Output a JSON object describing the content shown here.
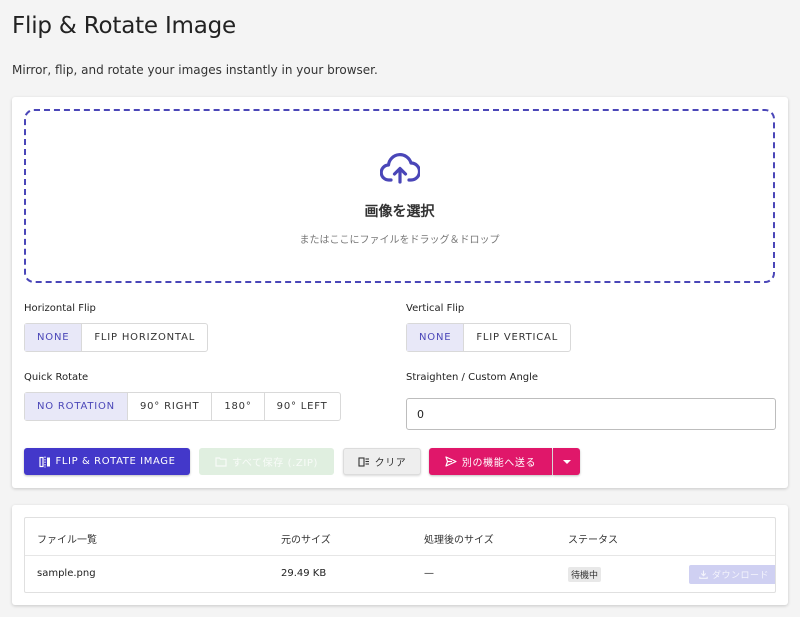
{
  "header": {
    "title": "Flip & Rotate Image",
    "subtitle": "Mirror, flip, and rotate your images instantly in your browser."
  },
  "dropzone": {
    "icon": "cloud-upload-icon",
    "title": "画像を選択",
    "hint": "またはここにファイルをドラッグ＆ドロップ"
  },
  "horizontal_flip": {
    "label": "Horizontal Flip",
    "options": [
      "NONE",
      "FLIP HORIZONTAL"
    ],
    "selected": "NONE"
  },
  "vertical_flip": {
    "label": "Vertical Flip",
    "options": [
      "NONE",
      "FLIP VERTICAL"
    ],
    "selected": "NONE"
  },
  "quick_rotate": {
    "label": "Quick Rotate",
    "options": [
      "NO ROTATION",
      "90° RIGHT",
      "180°",
      "90° LEFT"
    ],
    "selected": "NO ROTATION"
  },
  "custom_angle": {
    "label": "Straighten / Custom Angle",
    "value": "0"
  },
  "actions": {
    "primary": "FLIP & ROTATE IMAGE",
    "save_zip": "すべて保存 (.ZIP)",
    "clear": "クリア",
    "send": "別の機能へ送る"
  },
  "colors": {
    "accent": "#4338ca",
    "send": "#e0176a"
  },
  "file_table": {
    "headers": [
      "ファイル一覧",
      "元のサイズ",
      "処理後のサイズ",
      "ステータス"
    ],
    "rows": [
      {
        "name": "sample.png",
        "original_size": "29.49 KB",
        "processed_size": "—",
        "status": "待機中",
        "download": "ダウンロード"
      }
    ]
  }
}
